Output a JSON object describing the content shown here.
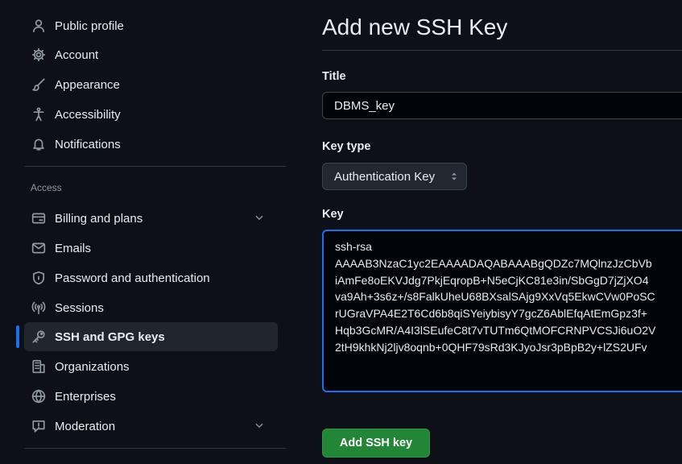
{
  "sidebar": {
    "items": [
      {
        "label": "Public profile",
        "icon": "person-icon"
      },
      {
        "label": "Account",
        "icon": "gear-icon"
      },
      {
        "label": "Appearance",
        "icon": "paintbrush-icon"
      },
      {
        "label": "Accessibility",
        "icon": "accessibility-icon"
      },
      {
        "label": "Notifications",
        "icon": "bell-icon"
      }
    ],
    "access_label": "Access",
    "access_items": [
      {
        "label": "Billing and plans",
        "icon": "credit-card-icon"
      },
      {
        "label": "Emails",
        "icon": "mail-icon"
      },
      {
        "label": "Password and authentication",
        "icon": "shield-lock-icon"
      },
      {
        "label": "Sessions",
        "icon": "broadcast-icon"
      },
      {
        "label": "SSH and GPG keys",
        "icon": "key-icon"
      },
      {
        "label": "Organizations",
        "icon": "organization-icon"
      },
      {
        "label": "Enterprises",
        "icon": "globe-icon"
      },
      {
        "label": "Moderation",
        "icon": "report-icon"
      }
    ]
  },
  "main": {
    "title": "Add new SSH Key",
    "title_field": {
      "label": "Title",
      "value": "DBMS_key"
    },
    "key_type": {
      "label": "Key type",
      "value": "Authentication Key"
    },
    "key_field": {
      "label": "Key",
      "lines": [
        "ssh-rsa",
        "AAAAB3NzaC1yc2EAAAADAQABAAABgQDZc7MQlnzJzCbVb",
        "iAmFe8oEKVJdg7PkjEqropB+N5eCjKC81e3in/SbGgD7jZjXO4",
        "va9Ah+3s6z+/s8FalkUheU68BXsalSAjg9XxVq5EkwCVw0PoSC",
        "rUGraVPA4E2T6Cd6b8qiSYeiybisyY7gcZ6AblEfqAtEmGpz3f+",
        "Hqb3GcMR/A4I3lSEufeC8t7vTUTm6QtMOFCRNPVCSJi6uO2V",
        "2tH9khkNj2ljv8oqnb+0QHF79sRd3KJyoJsr3pBpB2y+lZS2UFv"
      ]
    },
    "submit_label": "Add SSH key"
  },
  "colors": {
    "background": "#0d1117",
    "accent": "#1f6feb",
    "primary_button": "#238636"
  }
}
